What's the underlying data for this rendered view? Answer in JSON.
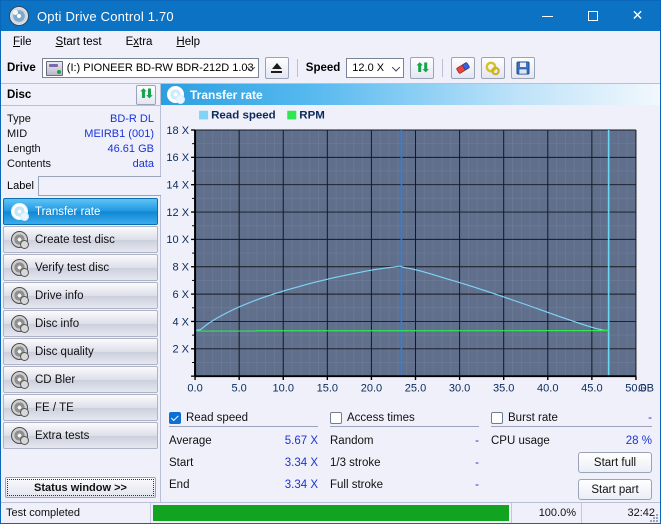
{
  "window": {
    "title": "Opti Drive Control 1.70",
    "icon": "disc-icon",
    "buttons": {
      "minimize": "–",
      "maximize": "□",
      "close": "✕"
    }
  },
  "menu": [
    {
      "label": "File",
      "accel": "F"
    },
    {
      "label": "Start test",
      "accel": "S"
    },
    {
      "label": "Extra",
      "accel": "x"
    },
    {
      "label": "Help",
      "accel": "H"
    }
  ],
  "toolbar": {
    "drive_label": "Drive",
    "drive_value": "(I:)  PIONEER BD-RW   BDR-212D 1.03",
    "eject_icon": "eject-icon",
    "speed_label": "Speed",
    "speed_value": "12.0 X",
    "refresh_icon": "refresh-icon",
    "erase_icon": "eraser-icon",
    "settings_icon": "gears-icon",
    "save_icon": "floppy-save-icon"
  },
  "disc": {
    "header": "Disc",
    "refresh_icon": "refresh-icon",
    "rows": [
      {
        "key": "Type",
        "value": "BD-R DL"
      },
      {
        "key": "MID",
        "value": "MEIRB1 (001)"
      },
      {
        "key": "Length",
        "value": "46.61 GB"
      },
      {
        "key": "Contents",
        "value": "data"
      }
    ],
    "label_key": "Label",
    "label_value": "",
    "label_placeholder": "",
    "label_button_icon": "cd-disc-icon"
  },
  "sidebar": {
    "items": [
      {
        "label": "Transfer rate",
        "selected": true
      },
      {
        "label": "Create test disc",
        "selected": false
      },
      {
        "label": "Verify test disc",
        "selected": false
      },
      {
        "label": "Drive info",
        "selected": false
      },
      {
        "label": "Disc info",
        "selected": false
      },
      {
        "label": "Disc quality",
        "selected": false
      },
      {
        "label": "CD Bler",
        "selected": false
      },
      {
        "label": "FE / TE",
        "selected": false
      },
      {
        "label": "Extra tests",
        "selected": false
      }
    ],
    "status_window_button": "Status window >>"
  },
  "panel": {
    "title": "Transfer rate",
    "icon": "disc-icon"
  },
  "chart_data": {
    "type": "line",
    "title": "Transfer rate",
    "xlabel": "GB",
    "ylabel": "X",
    "xlim": [
      0,
      50
    ],
    "ylim": [
      0,
      18
    ],
    "xticks": [
      0,
      5,
      10,
      15,
      20,
      25,
      30,
      35,
      40,
      45,
      50
    ],
    "xtick_labels": [
      "0.0",
      "5.0",
      "10.0",
      "15.0",
      "20.0",
      "25.0",
      "30.0",
      "35.0",
      "40.0",
      "45.0",
      "50.0"
    ],
    "xaxis_unit": "GB",
    "yticks": [
      0,
      2,
      4,
      6,
      8,
      10,
      12,
      14,
      16,
      18
    ],
    "ytick_labels": [
      "",
      "2 X",
      "4 X",
      "6 X",
      "8 X",
      "10 X",
      "12 X",
      "14 X",
      "16 X",
      "18 X"
    ],
    "grid": true,
    "grid_minor": true,
    "legend_position": "top-left",
    "plot_bg": "#5f6f8c",
    "legend": [
      {
        "name": "Read speed",
        "color": "#7fd4f5"
      },
      {
        "name": "RPM",
        "color": "#2ee84e"
      }
    ],
    "markers": [
      {
        "name": "layer-break",
        "x": 23.4,
        "color": "#2a7fe0"
      },
      {
        "name": "disc-end",
        "x": 46.9,
        "color": "#67d8f5"
      }
    ],
    "series": [
      {
        "name": "Read speed",
        "color": "#7fd4f5",
        "points": [
          [
            0.0,
            3.34
          ],
          [
            0.6,
            3.4
          ],
          [
            1.5,
            3.85
          ],
          [
            2.5,
            4.25
          ],
          [
            3.5,
            4.6
          ],
          [
            4.5,
            4.92
          ],
          [
            5.5,
            5.2
          ],
          [
            6.5,
            5.46
          ],
          [
            7.5,
            5.7
          ],
          [
            8.5,
            5.92
          ],
          [
            9.5,
            6.12
          ],
          [
            10.5,
            6.32
          ],
          [
            11.5,
            6.5
          ],
          [
            12.5,
            6.68
          ],
          [
            13.5,
            6.85
          ],
          [
            14.5,
            7.01
          ],
          [
            15.5,
            7.16
          ],
          [
            16.5,
            7.3
          ],
          [
            17.5,
            7.44
          ],
          [
            18.5,
            7.57
          ],
          [
            19.5,
            7.69
          ],
          [
            20.5,
            7.8
          ],
          [
            21.5,
            7.9
          ],
          [
            22.5,
            7.98
          ],
          [
            23.3,
            8.05
          ],
          [
            23.5,
            7.98
          ],
          [
            24.5,
            7.85
          ],
          [
            25.5,
            7.7
          ],
          [
            26.5,
            7.52
          ],
          [
            27.5,
            7.33
          ],
          [
            28.5,
            7.13
          ],
          [
            29.5,
            6.94
          ],
          [
            30.5,
            6.74
          ],
          [
            31.5,
            6.54
          ],
          [
            32.5,
            6.33
          ],
          [
            33.5,
            6.12
          ],
          [
            34.5,
            5.9
          ],
          [
            35.5,
            5.68
          ],
          [
            36.5,
            5.46
          ],
          [
            37.5,
            5.24
          ],
          [
            38.5,
            5.01
          ],
          [
            39.5,
            4.78
          ],
          [
            40.5,
            4.55
          ],
          [
            41.5,
            4.32
          ],
          [
            42.5,
            4.1
          ],
          [
            43.5,
            3.88
          ],
          [
            44.5,
            3.67
          ],
          [
            45.5,
            3.48
          ],
          [
            46.3,
            3.36
          ],
          [
            46.9,
            3.34
          ]
        ]
      },
      {
        "name": "RPM",
        "color": "#2ee84e",
        "points": [
          [
            0.2,
            3.3
          ],
          [
            6.8,
            3.3
          ],
          [
            7.0,
            3.32
          ],
          [
            23.4,
            3.32
          ],
          [
            40.0,
            3.33
          ],
          [
            46.9,
            3.33
          ]
        ]
      }
    ]
  },
  "stats": {
    "read_speed": {
      "title": "Read speed",
      "checked": true,
      "header_value": "",
      "rows": [
        {
          "key": "Average",
          "value": "5.67 X"
        },
        {
          "key": "Start",
          "value": "3.34 X"
        },
        {
          "key": "End",
          "value": "3.34 X"
        }
      ]
    },
    "access_times": {
      "title": "Access times",
      "checked": false,
      "header_value": "",
      "rows": [
        {
          "key": "Random",
          "value": "-"
        },
        {
          "key": "1/3 stroke",
          "value": "-"
        },
        {
          "key": "Full stroke",
          "value": "-"
        }
      ]
    },
    "burst_rate": {
      "title": "Burst rate",
      "checked": false,
      "header_value": "-",
      "rows": [
        {
          "key": "CPU usage",
          "value": "28 %"
        }
      ]
    },
    "buttons": {
      "start_full": "Start full",
      "start_part": "Start part"
    }
  },
  "statusbar": {
    "message": "Test completed",
    "progress_percent": 100.0,
    "progress_text": "100.0%",
    "elapsed_time": "32:42",
    "progress_color": "#12a420"
  }
}
